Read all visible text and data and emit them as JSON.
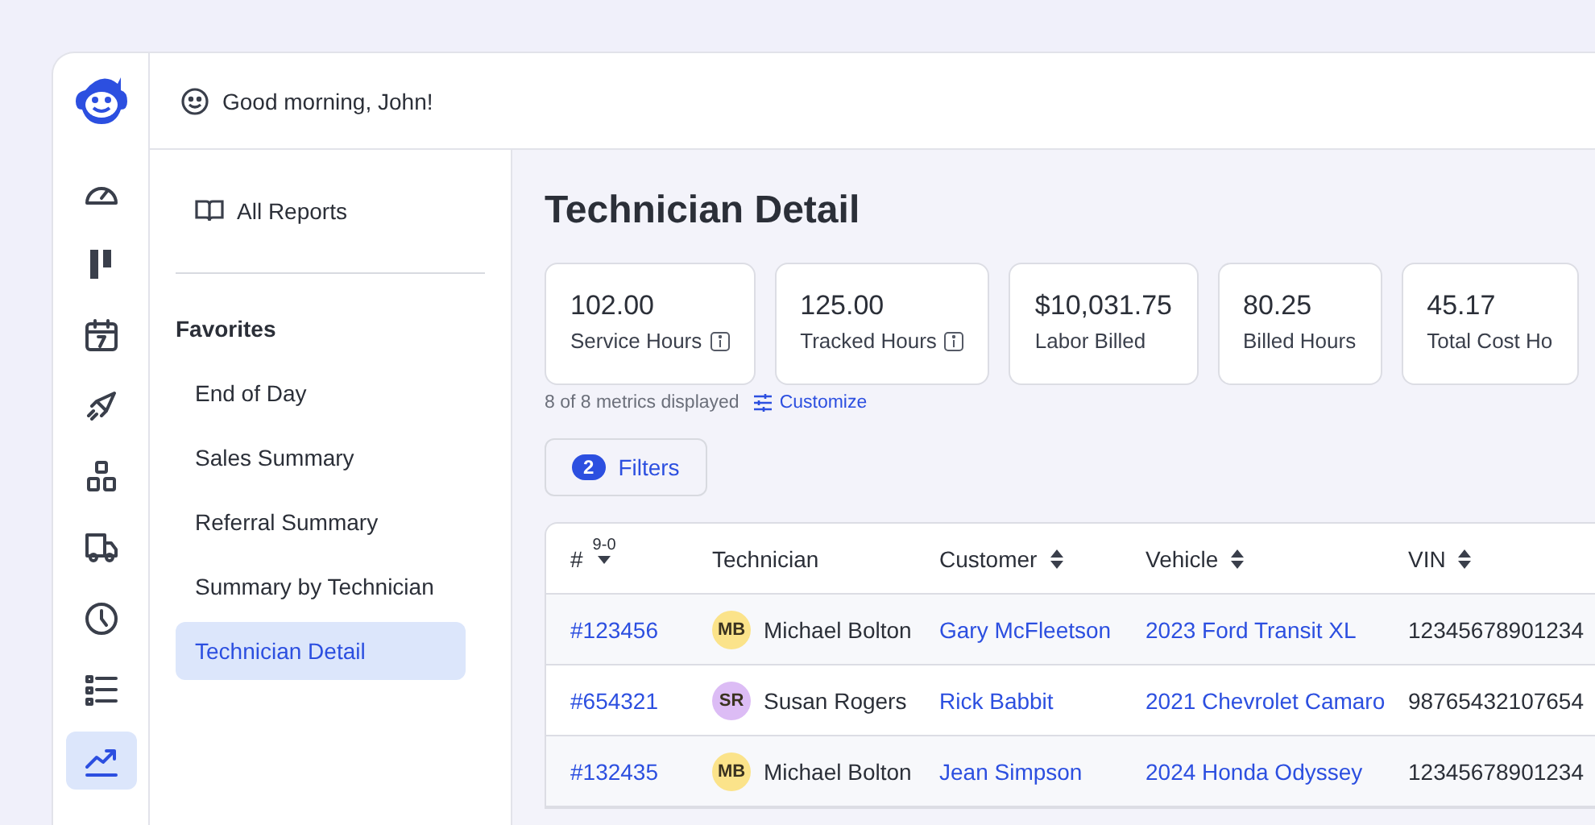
{
  "nav": [
    {
      "kind": "gauge",
      "selected": false
    },
    {
      "kind": "board",
      "selected": false
    },
    {
      "kind": "calendar",
      "selected": false
    },
    {
      "kind": "rocket",
      "selected": false
    },
    {
      "kind": "boxes",
      "selected": false
    },
    {
      "kind": "truck",
      "selected": false
    },
    {
      "kind": "clock",
      "selected": false
    },
    {
      "kind": "list",
      "selected": false
    },
    {
      "kind": "trend",
      "selected": true
    }
  ],
  "greeting": "Good morning, John!",
  "reports_sidebar": {
    "all_reports": "All Reports",
    "favorites_title": "Favorites",
    "items": [
      {
        "label": "End of Day",
        "selected": false
      },
      {
        "label": "Sales Summary",
        "selected": false
      },
      {
        "label": "Referral Summary",
        "selected": false
      },
      {
        "label": "Summary by Technician",
        "selected": false
      },
      {
        "label": "Technician Detail",
        "selected": true
      }
    ]
  },
  "page_title": "Technician Detail",
  "metrics": [
    {
      "value": "102.00",
      "label": "Service Hours",
      "info": true
    },
    {
      "value": "125.00",
      "label": "Tracked Hours",
      "info": true
    },
    {
      "value": "$10,031.75",
      "label": "Labor Billed",
      "info": false
    },
    {
      "value": "80.25",
      "label": "Billed Hours",
      "info": false
    },
    {
      "value": "45.17",
      "label": "Total Cost Ho",
      "info": false
    }
  ],
  "metrics_note": "8 of 8 metrics displayed",
  "customize": "Customize",
  "filters": {
    "count": "2",
    "label": "Filters"
  },
  "table": {
    "columns": [
      {
        "label": "#",
        "sort_hint": "9-0",
        "kind": "sorted"
      },
      {
        "label": "Technician",
        "kind": "plain"
      },
      {
        "label": "Customer",
        "kind": "sortable"
      },
      {
        "label": "Vehicle",
        "kind": "sortable"
      },
      {
        "label": "VIN",
        "kind": "sortable"
      }
    ],
    "rows": [
      {
        "number": "#123456",
        "initials": "MB",
        "color": "#fbe38a",
        "technician": "Michael Bolton",
        "customer": "Gary McFleetson",
        "vehicle": "2023 Ford Transit XL",
        "vin": "12345678901234"
      },
      {
        "number": "#654321",
        "initials": "SR",
        "color": "#dcbcf5",
        "technician": "Susan Rogers",
        "customer": "Rick Babbit",
        "vehicle": "2021 Chevrolet Camaro",
        "vin": "98765432107654"
      },
      {
        "number": "#132435",
        "initials": "MB",
        "color": "#fbe38a",
        "technician": "Michael Bolton",
        "customer": "Jean Simpson",
        "vehicle": "2024 Honda Odyssey",
        "vin": "12345678901234"
      }
    ]
  }
}
